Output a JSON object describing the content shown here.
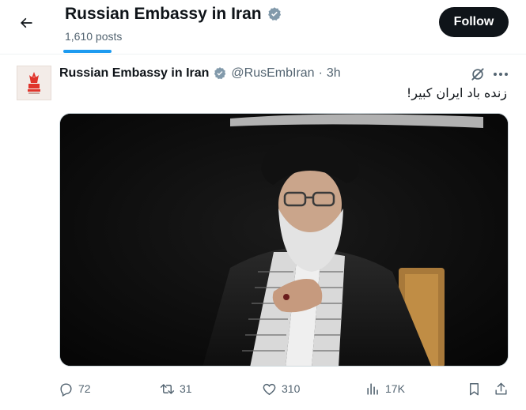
{
  "header": {
    "account_name": "Russian Embassy in Iran",
    "post_count": "1,610 posts",
    "follow_label": "Follow"
  },
  "post": {
    "author_name": "Russian Embassy in Iran",
    "handle": "@RusEmbIran",
    "separator": "·",
    "time": "3h",
    "text": "زنده باد ایران کبیر!",
    "actions": {
      "replies": "72",
      "reposts": "31",
      "likes": "310",
      "views": "17K"
    }
  },
  "colors": {
    "verified_badge": "#829aab",
    "follow_button": "#0f1419",
    "tab_indicator": "#1d9bf0",
    "secondary_text": "#536471"
  },
  "icons": [
    "back-arrow-icon",
    "verified-badge-icon",
    "grok-icon",
    "more-icon",
    "reply-icon",
    "repost-icon",
    "like-icon",
    "views-icon",
    "bookmark-icon",
    "share-icon"
  ]
}
